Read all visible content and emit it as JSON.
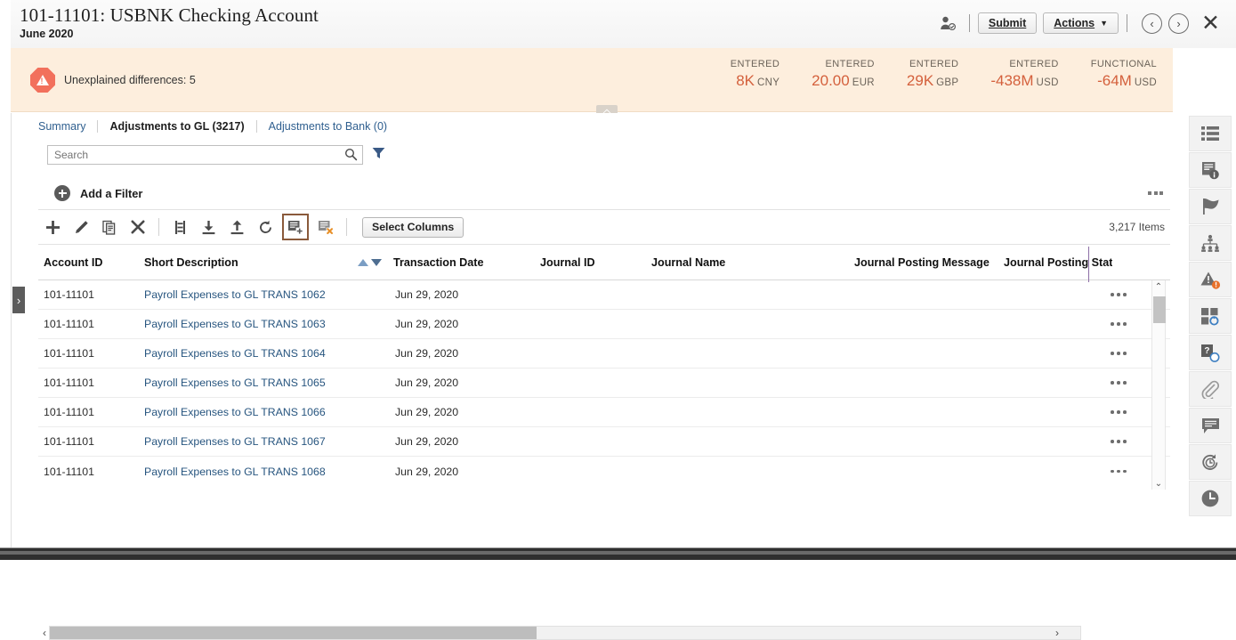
{
  "header": {
    "title_account": "101-11101:",
    "title_name": "USBNK Checking Account",
    "subtitle": "June 2020",
    "person_icon": "person-badge-icon",
    "submit_label": "Submit",
    "actions_label": "Actions",
    "caret": "▼",
    "prev_label": "‹",
    "next_label": "›",
    "close_label": "✕"
  },
  "banner": {
    "warning_icon": "warning-octagon-icon",
    "message": "Unexplained differences: 5",
    "collapse_icon": "chevron-up-icon",
    "kpis": [
      {
        "label": "ENTERED",
        "value": "8K",
        "currency": "CNY"
      },
      {
        "label": "ENTERED",
        "value": "20.00",
        "currency": "EUR"
      },
      {
        "label": "ENTERED",
        "value": "29K",
        "currency": "GBP"
      },
      {
        "label": "ENTERED",
        "value": "-438M",
        "currency": "USD"
      },
      {
        "label": "FUNCTIONAL",
        "value": "-64M",
        "currency": "USD"
      }
    ]
  },
  "tabs": [
    {
      "label": "Summary",
      "active": false
    },
    {
      "label": "Adjustments to GL (3217)",
      "active": true
    },
    {
      "label": "Adjustments to Bank (0)",
      "active": false
    }
  ],
  "search": {
    "value": "",
    "placeholder": "Search",
    "search_icon": "search-icon",
    "filter_icon": "funnel-icon"
  },
  "filter_row": {
    "add_filter_label": "Add a Filter",
    "add_icon": "plus-circle-icon",
    "overflow_icon": "more-options-icon"
  },
  "toolbar": {
    "icons": [
      {
        "name": "add-icon",
        "title": "Add"
      },
      {
        "name": "edit-pencil-icon",
        "title": "Edit"
      },
      {
        "name": "duplicate-icon",
        "title": "Duplicate"
      },
      {
        "name": "delete-x-icon",
        "title": "Delete"
      },
      {
        "name": "split-icon",
        "title": "Split"
      },
      {
        "name": "download-icon",
        "title": "Download"
      },
      {
        "name": "upload-icon",
        "title": "Upload"
      },
      {
        "name": "refresh-icon",
        "title": "Refresh"
      },
      {
        "name": "add-to-list-icon",
        "title": "Add to List"
      },
      {
        "name": "remove-from-list-icon",
        "title": "Remove from List"
      }
    ],
    "select_columns_label": "Select Columns",
    "items_count": "3,217 Items"
  },
  "table": {
    "columns": [
      "Account ID",
      "Short Description",
      "Transaction Date",
      "Journal ID",
      "Journal Name",
      "Journal Posting Message",
      "Journal Posting Statu"
    ],
    "sort": {
      "asc_icon": "sort-ascending-icon",
      "desc_icon": "sort-descending-icon",
      "column": "Transaction Date"
    },
    "rows": [
      {
        "account_id": "101-11101",
        "short_description": "Payroll Expenses to GL TRANS 1062",
        "transaction_date": "Jun 29, 2020",
        "journal_id": "",
        "journal_name": "",
        "journal_posting_message": "",
        "journal_posting_status": ""
      },
      {
        "account_id": "101-11101",
        "short_description": "Payroll Expenses to GL TRANS 1063",
        "transaction_date": "Jun 29, 2020",
        "journal_id": "",
        "journal_name": "",
        "journal_posting_message": "",
        "journal_posting_status": ""
      },
      {
        "account_id": "101-11101",
        "short_description": "Payroll Expenses to GL TRANS 1064",
        "transaction_date": "Jun 29, 2020",
        "journal_id": "",
        "journal_name": "",
        "journal_posting_message": "",
        "journal_posting_status": ""
      },
      {
        "account_id": "101-11101",
        "short_description": "Payroll Expenses to GL TRANS 1065",
        "transaction_date": "Jun 29, 2020",
        "journal_id": "",
        "journal_name": "",
        "journal_posting_message": "",
        "journal_posting_status": ""
      },
      {
        "account_id": "101-11101",
        "short_description": "Payroll Expenses to GL TRANS 1066",
        "transaction_date": "Jun 29, 2020",
        "journal_id": "",
        "journal_name": "",
        "journal_posting_message": "",
        "journal_posting_status": ""
      },
      {
        "account_id": "101-11101",
        "short_description": "Payroll Expenses to GL TRANS 1067",
        "transaction_date": "Jun 29, 2020",
        "journal_id": "",
        "journal_name": "",
        "journal_posting_message": "",
        "journal_posting_status": ""
      },
      {
        "account_id": "101-11101",
        "short_description": "Payroll Expenses to GL TRANS 1068",
        "transaction_date": "Jun 29, 2020",
        "journal_id": "",
        "journal_name": "",
        "journal_posting_message": "",
        "journal_posting_status": ""
      }
    ],
    "row_menu_icon": "row-actions-icon"
  },
  "scrollbars": {
    "v_up": "⌃",
    "v_down": "⌄",
    "h_left": "‹",
    "h_right": "›"
  },
  "right_rail": [
    {
      "name": "list-icon"
    },
    {
      "name": "document-info-icon"
    },
    {
      "name": "flag-icon"
    },
    {
      "name": "org-chart-icon"
    },
    {
      "name": "alert-warning-icon"
    },
    {
      "name": "dashboard-grid-icon"
    },
    {
      "name": "help-question-icon"
    },
    {
      "name": "attachment-paperclip-icon"
    },
    {
      "name": "comment-icon"
    },
    {
      "name": "history-refresh-icon"
    },
    {
      "name": "clock-icon"
    }
  ],
  "left_handle": {
    "icon": "expand-chevron-right-icon",
    "label": "›"
  },
  "colors": {
    "banner_bg": "#fdeedd",
    "kpi_value": "#d4603c",
    "link": "#27557f",
    "highlight_border": "#8a5a3b",
    "header_divider": "#8d6ea6"
  }
}
